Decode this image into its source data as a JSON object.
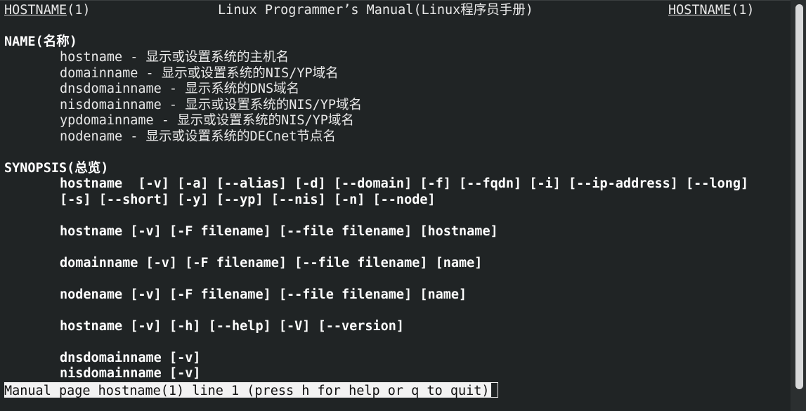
{
  "header": {
    "left": "HOSTNAME",
    "left_suffix": "(1)",
    "center": "Linux Programmer’s Manual(Linux程序员手册)",
    "right": "HOSTNAME",
    "right_suffix": "(1)"
  },
  "sections": {
    "name_heading": "NAME(名称)",
    "name_lines": [
      "hostname - 显示或设置系统的主机名",
      "domainname - 显示或设置系统的NIS/YP域名",
      "dnsdomainname - 显示系统的DNS域名",
      "nisdomainname - 显示或设置系统的NIS/YP域名",
      "ypdomainname - 显示或设置系统的NIS/YP域名",
      "nodename - 显示或设置系统的DECnet节点名"
    ],
    "synopsis_heading": "SYNOPSIS(总览)",
    "synopsis_lines": [
      "hostname  [-v] [-a] [--alias] [-d] [--domain] [-f] [--fqdn] [-i] [--ip-address] [--long]",
      "[-s] [--short] [-y] [--yp] [--nis] [-n] [--node]",
      "hostname [-v] [-F filename] [--file filename] [hostname]",
      "domainname [-v] [-F filename] [--file filename] [name]",
      "nodename [-v] [-F filename] [--file filename] [name]",
      "hostname [-v] [-h] [--help] [-V] [--version]",
      "dnsdomainname [-v]",
      "nisdomainname [-v]"
    ]
  },
  "status_line": "Manual page hostname(1) line 1 (press h for help or q to quit)"
}
